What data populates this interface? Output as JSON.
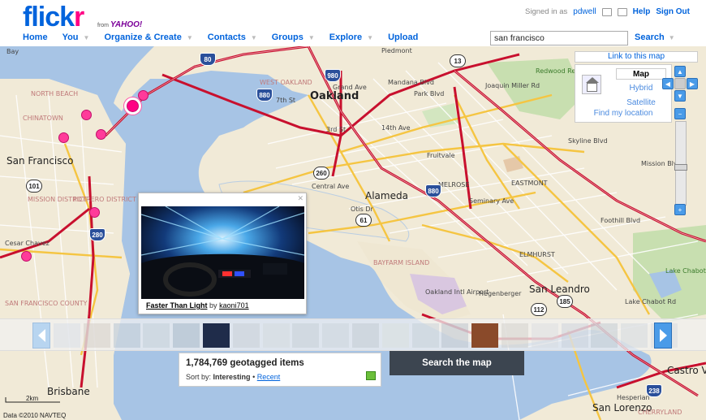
{
  "header": {
    "logo_main": "flick",
    "logo_end": "r",
    "logo_from": "from",
    "logo_yahoo": "YAHOO!",
    "signed_in_as": "Signed in as",
    "username": "pdwell",
    "help": "Help",
    "sign_out": "Sign Out",
    "nav": [
      {
        "label": "Home",
        "has_menu": false
      },
      {
        "label": "You",
        "has_menu": true
      },
      {
        "label": "Organize & Create",
        "has_menu": true
      },
      {
        "label": "Contacts",
        "has_menu": true
      },
      {
        "label": "Groups",
        "has_menu": true
      },
      {
        "label": "Explore",
        "has_menu": true
      },
      {
        "label": "Upload",
        "has_menu": false
      }
    ],
    "search_value": "san francisco",
    "search_button": "Search"
  },
  "map": {
    "link_to_map": "Link to this map",
    "types": [
      "Map",
      "Hybrid",
      "Satellite"
    ],
    "selected_type": "Map",
    "find_location": "Find my location",
    "zoom_level_fraction": 0.55,
    "labels": {
      "oakland": "Oakland",
      "alameda": "Alameda",
      "san_francisco": "San Francisco",
      "san_leandro": "San Leandro",
      "piedmont": "Piedmont",
      "west_oakland": "WEST OAKLAND",
      "north_beach": "NORTH BEACH",
      "chinatown": "CHINATOWN",
      "mission": "MISSION DISTRICT",
      "potrero": "POTRERO DISTRICT",
      "sf_county": "SAN FRANCISCO COUNTY",
      "bayfarm": "BAYFARM ISLAND",
      "melrose": "MELROSE",
      "eastmont": "EASTMONT",
      "elmhurst": "ELMHURST",
      "brisbane": "Brisbane",
      "castro": "Castro V",
      "san_lorenzo": "San Lorenzo",
      "cherryland": "CHERRYLAND",
      "redwood": "Redwood Regional Park",
      "joaquin": "Joaquin Miller Rd",
      "lake_chabot": "Lake Chabot Regional Park",
      "cesar": "Cesar Chavez",
      "central_ave": "Central Ave",
      "otis": "Otis Dr",
      "seminary": "Seminary Ave",
      "mandana": "Mandana Blvd",
      "park_blvd": "Park Blvd",
      "fourteenth": "14th Ave",
      "seventh": "7th St",
      "third": "3rd St",
      "hegenberger": "Hegenberger",
      "airport": "Oakland Intl Airport",
      "fruitvale": "Fruitvale",
      "skyline": "Skyline Blvd",
      "foothill": "Foothill Blvd",
      "mission_blvd": "Mission Blvd",
      "hesperian": "Hesperian",
      "lake": "Lake Chabot Rd",
      "bay": "Bay",
      "grand": "Grand Ave"
    },
    "shields": [
      "80",
      "980",
      "880",
      "13",
      "260",
      "61",
      "880",
      "101",
      "280",
      "112",
      "185",
      "238"
    ]
  },
  "popup": {
    "photo_title": "Faster Than Light",
    "by": "by",
    "author": "kaoni701"
  },
  "info": {
    "count": "1,784,769 geotagged items",
    "sort_label": "Sort by:",
    "sort_selected": "Interesting",
    "sort_sep": "•",
    "sort_other": "Recent",
    "search_map": "Search the map",
    "scale": "2km",
    "copyright": "Data ©2010 NAVTEQ"
  },
  "filmstrip": {
    "colors": [
      "#cfd8e4",
      "#c8c0b8",
      "#9fb2c8",
      "#b8c4d0",
      "#8ea3b8",
      "#1f2c4a",
      "#c0c4cc",
      "#d0d4d8",
      "#bcc4cc",
      "#c4ccd4",
      "#b8c0c8",
      "#d8dcd8",
      "#bcc8d0",
      "#a8b4c0",
      "#8a4a2a",
      "#c8c4c0",
      "#d4d8dc",
      "#c0c8d4",
      "#b0bcc8",
      "#c8d0d8",
      "#d0d4dc"
    ],
    "highlighted": [
      5,
      14
    ]
  }
}
